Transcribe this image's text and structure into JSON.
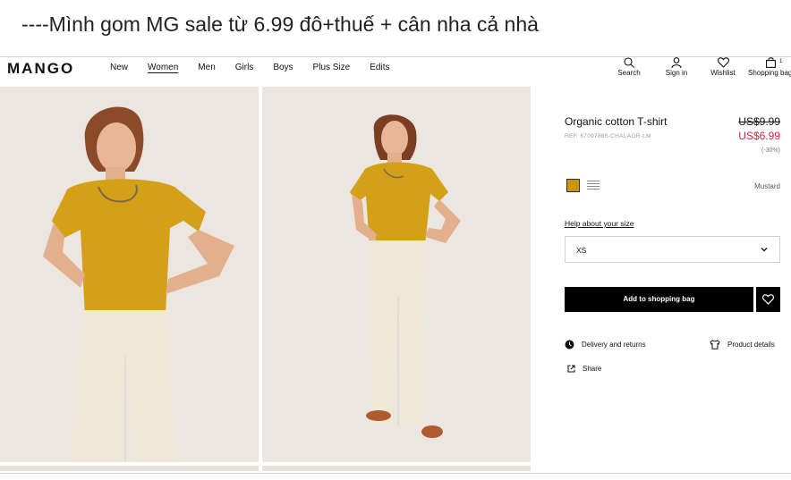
{
  "caption": "----Mình gom MG sale từ 6.99 đô+thuế + cân nha cả nhà",
  "header": {
    "logo": "MANGO",
    "nav": [
      "New",
      "Women",
      "Men",
      "Girls",
      "Boys",
      "Plus Size",
      "Edits"
    ],
    "active_nav": "Women",
    "icons": {
      "search": "Search",
      "signin": "Sign in",
      "wishlist": "Wishlist",
      "bag": "Shopping bag",
      "bag_count": "1"
    }
  },
  "product": {
    "title": "Organic cotton T-shirt",
    "ref": "REF. 67097885-CHALAOR-LM",
    "old_price": "US$9.99",
    "new_price": "US$6.99",
    "discount": "(-30%)",
    "color_name": "Mustard",
    "help_size": "Help about your size",
    "size_value": "XS",
    "add_button": "Add to shopping bag",
    "delivery": "Delivery and returns",
    "product_details": "Product details",
    "share": "Share"
  },
  "colors": {
    "price_red": "#c8273f",
    "mustard": "#c9960e",
    "shirt": "#d4a017",
    "pants": "#efe7d8",
    "background": "#ece6e1"
  }
}
